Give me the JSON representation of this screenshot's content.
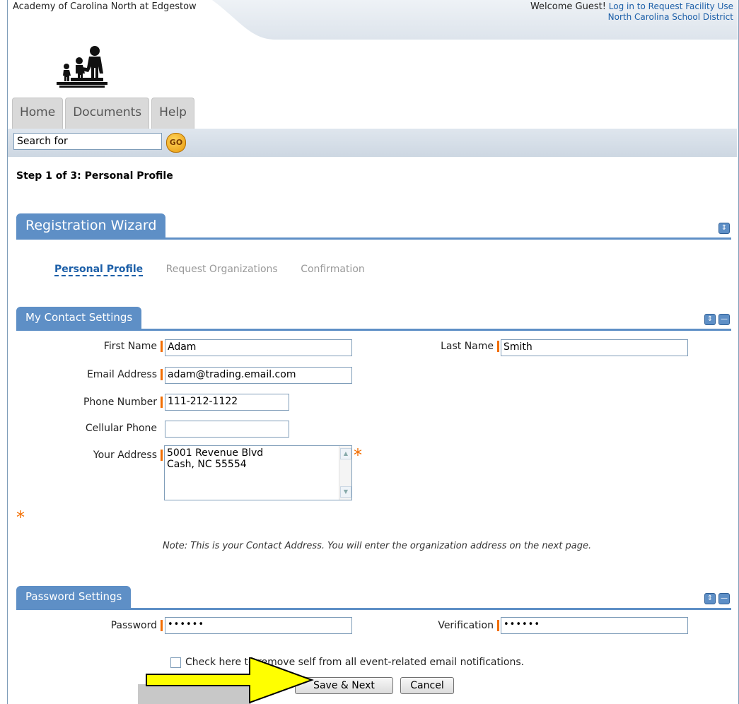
{
  "header": {
    "school_name": "Academy of Carolina North at Edgestow",
    "welcome": "Welcome Guest!",
    "login_link": "Log in to Request Facility Use",
    "district": "North Carolina School District"
  },
  "tabs": [
    {
      "label": "Home"
    },
    {
      "label": "Documents"
    },
    {
      "label": "Help"
    }
  ],
  "search": {
    "value": "Search for",
    "go_label": "GO"
  },
  "step_title": "Step 1 of 3: Personal Profile",
  "wizard": {
    "title": "Registration Wizard",
    "steps": [
      "Personal Profile",
      "Request Organizations",
      "Confirmation"
    ],
    "active_step": "Personal Profile"
  },
  "contact": {
    "title": "My Contact Settings",
    "first_name_label": "First Name",
    "first_name": "Adam",
    "last_name_label": "Last Name",
    "last_name": "Smith",
    "email_label": "Email Address",
    "email": "adam@trading.email.com",
    "phone_label": "Phone Number",
    "phone": "111-212-1122",
    "cell_label": "Cellular Phone",
    "cell": "",
    "address_label": "Your Address",
    "address_line1": "5001 Revenue Blvd",
    "address_line2": "Cash, NC 55554",
    "note": "Note: This is your Contact Address. You will enter the organization address on the next page."
  },
  "password": {
    "title": "Password Settings",
    "password_label": "Password",
    "password_mask": "••••••",
    "verification_label": "Verification",
    "verification_mask": "••••••"
  },
  "notify_checkbox": {
    "label": "Check here to remove self from all event-related email notifications.",
    "checked": false
  },
  "buttons": {
    "save_next": "Save & Next",
    "cancel": "Cancel"
  },
  "colors": {
    "accent": "#5e8fc6",
    "required": "#f26d00",
    "link": "#1c5fa8",
    "arrow": "#ffff00"
  }
}
